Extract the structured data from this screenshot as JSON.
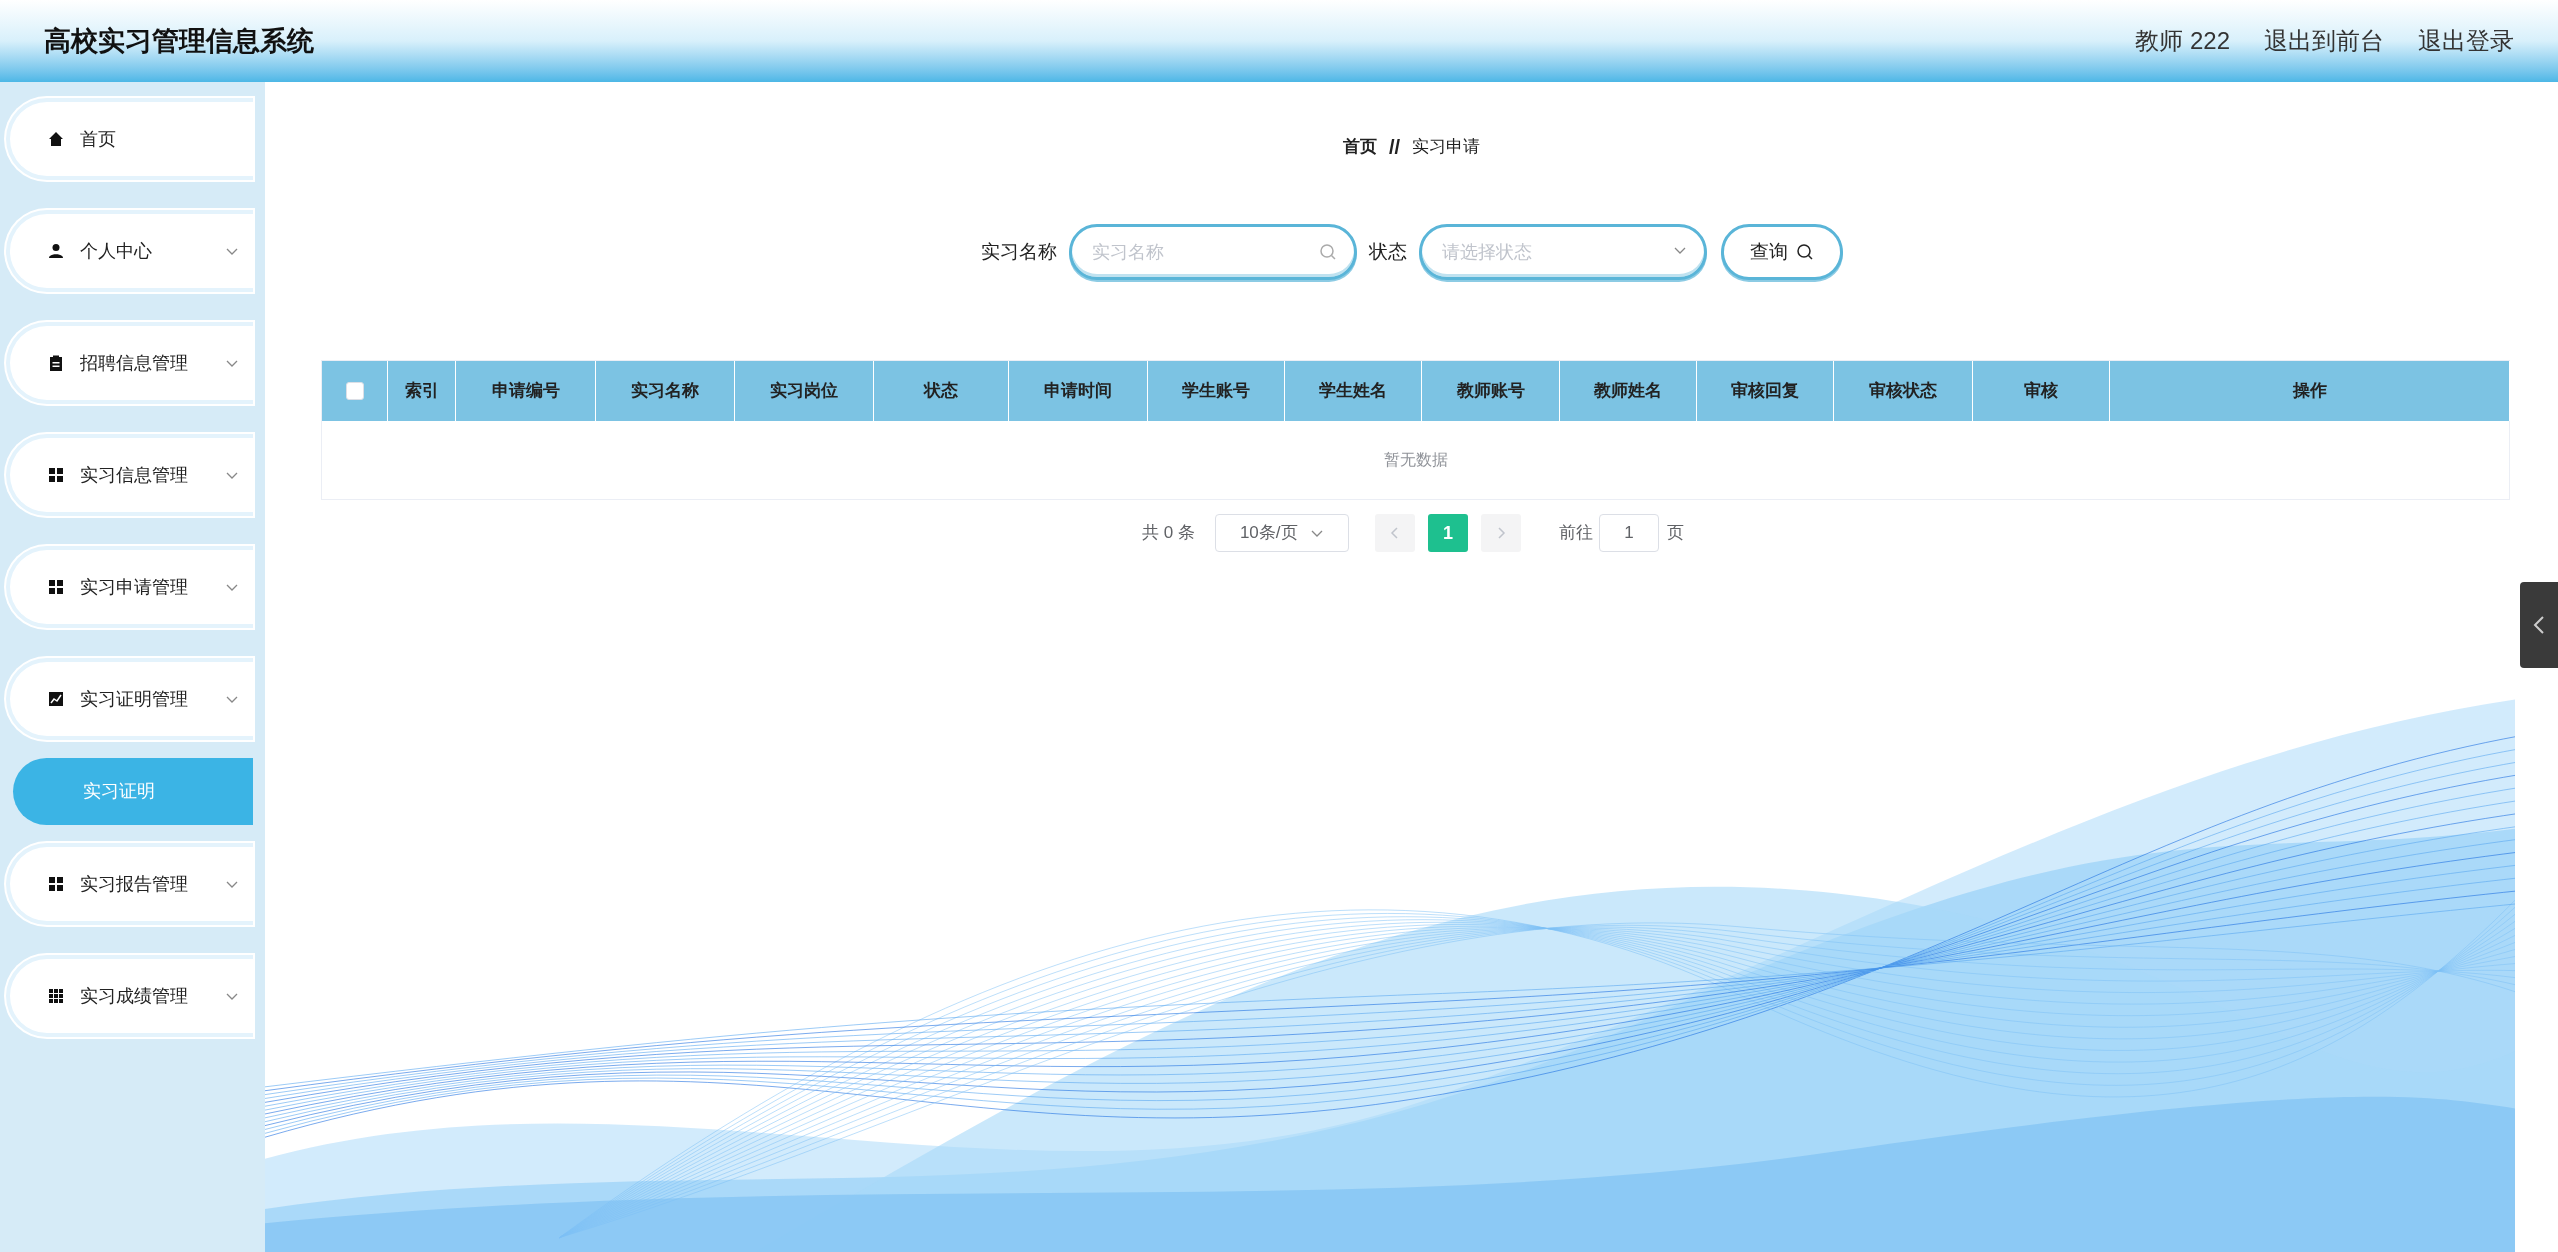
{
  "header": {
    "title": "高校实习管理信息系统",
    "user": "教师 222",
    "links": [
      "退出到前台",
      "退出登录"
    ]
  },
  "sidebar": {
    "items": [
      {
        "label": "首页",
        "kind": "home"
      },
      {
        "label": "个人中心",
        "kind": "user",
        "has_submenu": true
      },
      {
        "label": "招聘信息管理",
        "kind": "clipboard",
        "has_submenu": true
      },
      {
        "label": "实习信息管理",
        "kind": "grid",
        "has_submenu": true
      },
      {
        "label": "实习申请管理",
        "kind": "grid",
        "has_submenu": true
      },
      {
        "label": "实习证明管理",
        "kind": "chart",
        "has_submenu": true,
        "children": [
          {
            "label": "实习证明",
            "selected": true
          }
        ]
      },
      {
        "label": "实习报告管理",
        "kind": "grid",
        "has_submenu": true
      },
      {
        "label": "实习成绩管理",
        "kind": "grid9",
        "has_submenu": true
      }
    ]
  },
  "breadcrumb": [
    "首页",
    "实习申请"
  ],
  "breadcrumb_separator": "//",
  "search": {
    "fields": [
      {
        "label": "实习名称",
        "placeholder": "实习名称",
        "kind": "text"
      },
      {
        "label": "状态",
        "placeholder": "请选择状态",
        "kind": "select"
      }
    ],
    "button": "查询"
  },
  "table": {
    "select_all_checked": false,
    "columns": [
      "索引",
      "申请编号",
      "实习名称",
      "实习岗位",
      "状态",
      "申请时间",
      "学生账号",
      "学生姓名",
      "教师账号",
      "教师姓名",
      "审核回复",
      "审核状态",
      "审核",
      "操作"
    ],
    "empty_text": "暂无数据"
  },
  "pagination": {
    "total": "共 0 条",
    "page_size": "10条/页",
    "pages": [
      {
        "label": "1",
        "selected": true
      }
    ],
    "goto_label": "前往",
    "goto_value": "1",
    "goto_suffix": "页"
  }
}
